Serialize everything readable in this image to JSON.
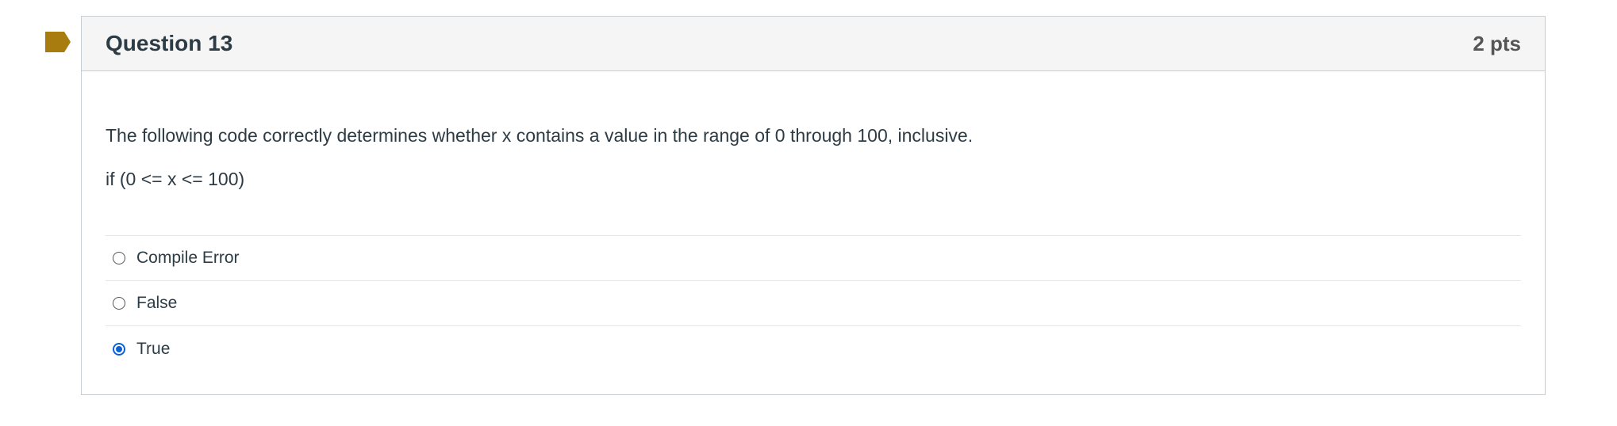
{
  "question": {
    "title": "Question 13",
    "points": "2 pts",
    "text": "The following code correctly determines whether x contains a value in the range of 0 through 100, inclusive.",
    "code": "if (0 <= x <= 100)",
    "answers": [
      {
        "label": "Compile Error",
        "selected": false
      },
      {
        "label": "False",
        "selected": false
      },
      {
        "label": "True",
        "selected": true
      }
    ]
  },
  "colors": {
    "flag": "#a87c0e",
    "header_bg": "#f5f5f5",
    "selected_radio": "#0b61d8"
  },
  "icons": {
    "flag": "bookmark-flag-icon",
    "radio": "radio-button-icon"
  }
}
